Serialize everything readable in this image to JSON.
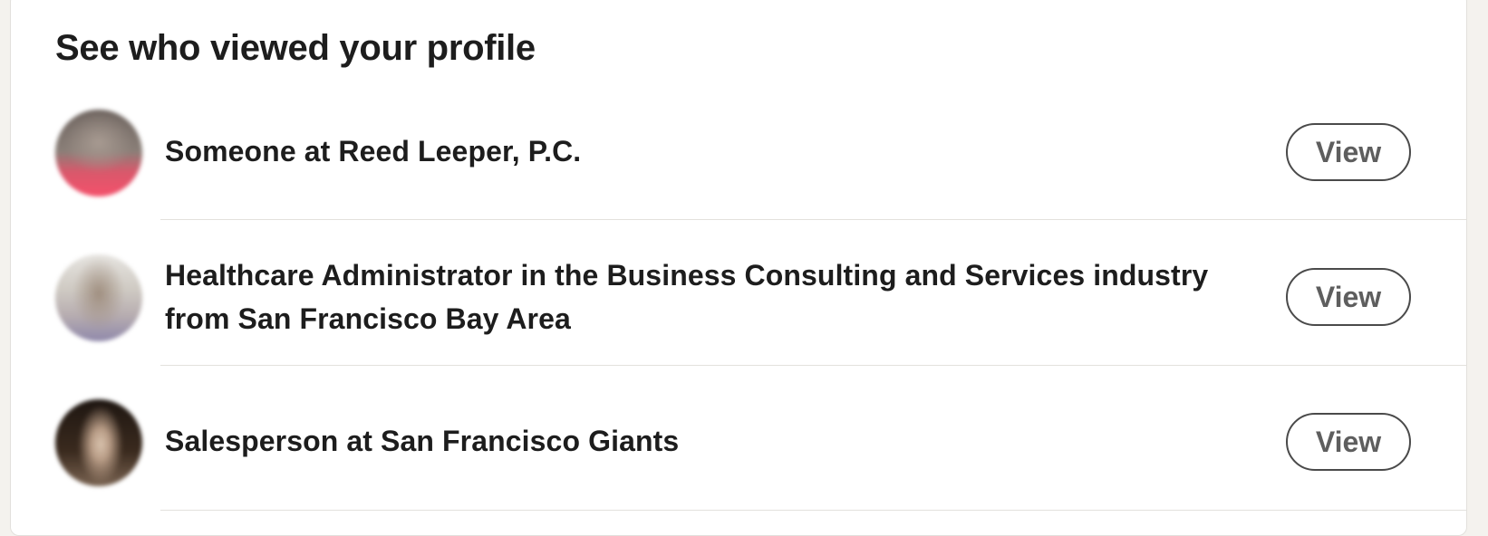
{
  "card": {
    "title": "See who viewed your profile"
  },
  "viewers": [
    {
      "label": "Someone at Reed Leeper, P.C.",
      "button_label": "View",
      "avatar_colors": [
        "#7e736c",
        "#9c8f86",
        "#f0556f"
      ]
    },
    {
      "label": "Healthcare Administrator in the Business Consulting and Services industry from San Francisco Bay Area",
      "button_label": "View",
      "avatar_colors": [
        "#d9d7d2",
        "#a89c8e",
        "#8d86a8"
      ]
    },
    {
      "label": "Salesperson at San Francisco Giants",
      "button_label": "View",
      "avatar_colors": [
        "#2a1f18",
        "#c7b09a",
        "#3b2a1f"
      ]
    }
  ]
}
